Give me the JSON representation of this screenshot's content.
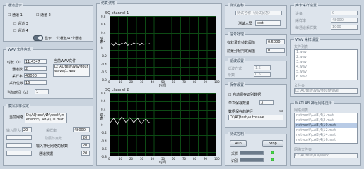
{
  "channel_display": {
    "title": "通道显示",
    "ch1": "通道 1",
    "ch2": "通道 2",
    "ch3": "通道 3",
    "ch4": "通道 4",
    "toggle_label": "显示 1 个通道/4 个通道"
  },
  "wav_info": {
    "title": "WAV 文件信息",
    "duration_label": "时长（s）",
    "duration_value": "11.4347",
    "channels_label": "通道数",
    "channels_value": "2",
    "rate_label": "采样率",
    "rate_value": "48000",
    "bits_label": "采样位数",
    "bits_value": "16",
    "path_label": "当前WAV文件",
    "path_value": "D:\\AQtest\\wav\\fourwave\\1.wav",
    "time_label": "当前时间（s）",
    "time_value": "1"
  },
  "simulate": {
    "title": "模拟采样设定",
    "path_label": "当前网络",
    "path_value": "D:\\AQtest\\NN\\work\\ network\\LAB\\4\\10.mat",
    "rows": [
      {
        "label": "输入层大小",
        "value": "20"
      },
      {
        "label": "采样率",
        "value": "48000"
      },
      {
        "label": "隐层节点数",
        "value": "20"
      },
      {
        "label": "输入神经网络的帧数",
        "value": "20"
      },
      {
        "label": "通道数据",
        "value": "20"
      }
    ]
  },
  "charts": {
    "title": "仿真波形",
    "channel1_title": "SQ channel 1",
    "channel2_title": "SQ channel 2",
    "ylabel": "幅值",
    "xlabel": "时间",
    "y_ticks": [
      "0.8",
      "0.6",
      "0.4",
      "0.2",
      "0",
      "-0.2",
      "-0.4",
      "-0.6",
      "-0.8"
    ],
    "x_ticks": [
      "0",
      "10",
      "20",
      "30",
      "40",
      "50",
      "60",
      "70",
      "80",
      "90",
      "100"
    ]
  },
  "chart_data": [
    {
      "type": "line",
      "title": "SQ channel 1",
      "xlim": [
        0,
        100
      ],
      "ylim": [
        -1,
        1
      ],
      "series": [
        {
          "values": [
            0.1,
            0.14,
            0.08,
            0.16,
            0.11,
            0.09,
            0.15,
            0.12,
            0.17,
            0.08,
            0.13,
            0.1,
            0.16,
            0.12,
            0.14,
            0.09,
            0.15,
            0.11,
            0.13,
            0.12,
            0.14
          ]
        }
      ],
      "x_range": [
        0,
        38
      ]
    },
    {
      "type": "line",
      "title": "SQ channel 2",
      "xlim": [
        0,
        100
      ],
      "ylim": [
        -1,
        1
      ],
      "series": [
        {
          "values": [
            0.05,
            0.12,
            0.2,
            0.1,
            0.02,
            0.15,
            0.24,
            0.18,
            0.08,
            0.12,
            0.22,
            0.16,
            0.06,
            0.14,
            0.2,
            0.1,
            0.04,
            0.12,
            0.18,
            0.1,
            0.06
          ]
        }
      ],
      "x_range": [
        0,
        38
      ]
    }
  ],
  "test_name": {
    "title": "测试名称",
    "hint": "测试名称（测试状态）",
    "label": "测试人员",
    "value": "test"
  },
  "signal_process": {
    "title": "信号处理",
    "row1_label": "有效录音帧数阈值",
    "row1_value": "0.5000",
    "row2_label": "前景分帧判定阈值",
    "row2_value": "0"
  },
  "filter": {
    "title": "滤波设置",
    "opt1_label": "滤波方式",
    "opt1_value": "1.5",
    "opt2_label": "阶数",
    "opt2_value": "0.5"
  },
  "save": {
    "title": "保存设置",
    "chk1": "自动保存识别数据",
    "row_label": "单次保存数量",
    "row_value": "3",
    "path_label": "数据保存的路径",
    "path_value": "D:\\AQtest\\autosave"
  },
  "run": {
    "title": "测试控制",
    "run_label": "Run",
    "stop_label": "Stop",
    "status1_label": "采样",
    "status2_label": "识别"
  },
  "params": {
    "title": "声卡采样设置",
    "rows": [
      {
        "label": "设备",
        "value": "0"
      },
      {
        "label": "采样率",
        "value": "48000"
      },
      {
        "label": "每通道采样数",
        "value": "1000"
      }
    ]
  },
  "wav_list": {
    "title": "WAV 采样设置",
    "label": "文件列表",
    "items": [
      "1.wav",
      "2.wav",
      "3.wav",
      "4.wav",
      "5.wav",
      "6.wav"
    ],
    "path_label": "文件夹",
    "path_value": "D:\\AQtest\\wav\\fourwave"
  },
  "matlab": {
    "title": "MATLAB 神经网络选择",
    "label": "网络列表",
    "items": [
      "network\\LAB\\4\\1.mat",
      "network\\LAB\\4\\2.mat",
      "network\\LAB\\4\\10.mat",
      "network\\LAB\\4\\12.mat",
      "network\\LAB\\4\\14.mat",
      "network\\LAB\\4\\16.mat"
    ],
    "selected_index": 2,
    "path_label": "网络文件夹",
    "path_value": "D:\\AQtest\\NN\\work"
  },
  "colors": {
    "plot_bg": "#000000",
    "grid": "#0d4a14",
    "trace": "#e6e6e6",
    "led_on": "#3ddc3d",
    "led_off": "#2a6a2a"
  }
}
